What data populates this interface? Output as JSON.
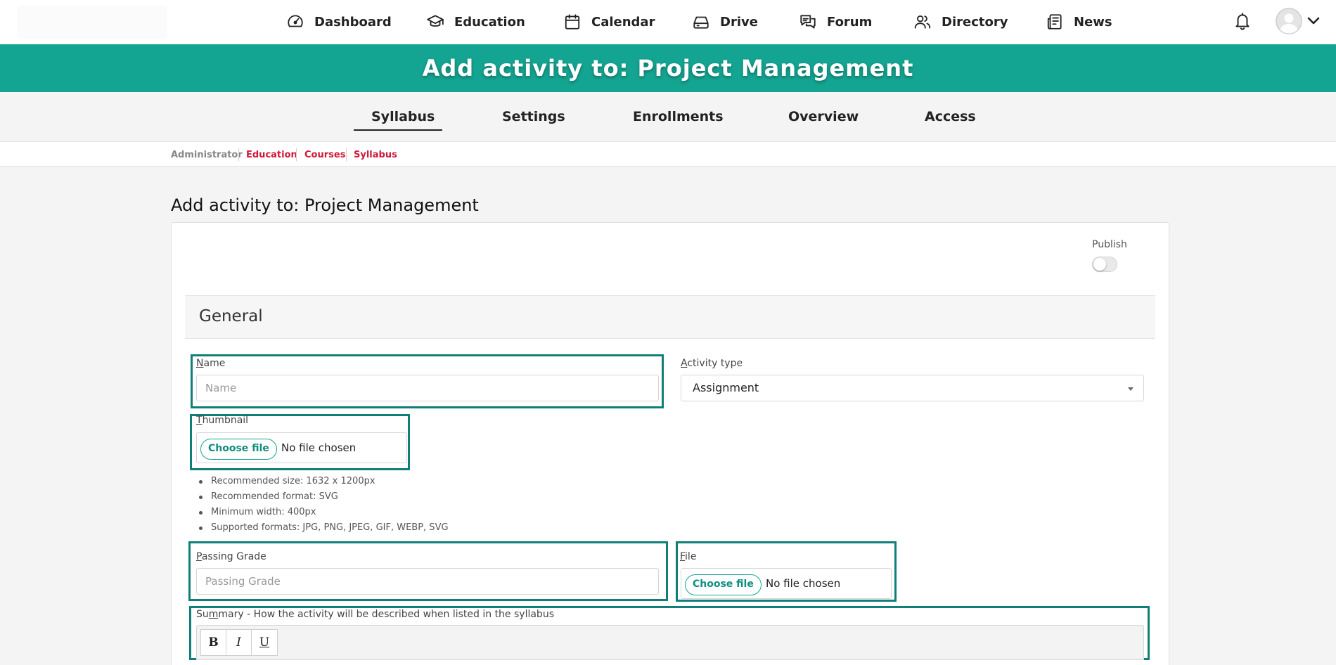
{
  "nav": {
    "items": [
      {
        "label": "Dashboard",
        "icon": "dashboard-gauge-icon"
      },
      {
        "label": "Education",
        "icon": "graduation-cap-icon"
      },
      {
        "label": "Calendar",
        "icon": "calendar-icon"
      },
      {
        "label": "Drive",
        "icon": "drive-icon"
      },
      {
        "label": "Forum",
        "icon": "chat-bubbles-icon"
      },
      {
        "label": "Directory",
        "icon": "people-icon"
      },
      {
        "label": "News",
        "icon": "newspaper-icon"
      }
    ],
    "notifications_icon": "bell-icon",
    "user_icon": "user-avatar-icon"
  },
  "banner": {
    "title": "Add activity to: Project Management"
  },
  "tabs": [
    {
      "label": "Syllabus",
      "active": true
    },
    {
      "label": "Settings"
    },
    {
      "label": "Enrollments"
    },
    {
      "label": "Overview"
    },
    {
      "label": "Access"
    }
  ],
  "breadcrumb": [
    {
      "label": "Administrator"
    },
    {
      "label": "Education"
    },
    {
      "label": "Courses"
    },
    {
      "label": "Syllabus"
    }
  ],
  "page_title": "Add activity to: Project Management",
  "form": {
    "publish_label": "Publish",
    "publish_on": false,
    "section_title": "General",
    "name": {
      "label_first": "N",
      "label_rest": "ame",
      "placeholder": "Name",
      "value": ""
    },
    "activity_type": {
      "label_first": "A",
      "label_rest": "ctivity type",
      "value": "Assignment"
    },
    "thumbnail": {
      "label_first": "T",
      "label_rest": "humbnail",
      "button": "Choose file",
      "status": "No file chosen"
    },
    "thumbnail_hints": [
      "Recommended size: 1632 x 1200px",
      "Recommended format: SVG",
      "Minimum width: 400px",
      "Supported formats: JPG, PNG, JPEG, GIF, WEBP, SVG"
    ],
    "passing_grade": {
      "label_first": "P",
      "label_rest": "assing Grade",
      "placeholder": "Passing Grade",
      "value": ""
    },
    "file": {
      "label_first": "F",
      "label_rest": "ile",
      "button": "Choose file",
      "status": "No file chosen"
    },
    "summary": {
      "label_pre": "Su",
      "label_underline": "m",
      "label_rest": "mary - How the activity will be described when listed in the syllabus"
    },
    "editor_buttons": [
      "B",
      "I",
      "U"
    ]
  },
  "colors": {
    "accent": "#14a592",
    "highlight_border": "#0f7f78",
    "breadcrumb_link": "#d0193a"
  }
}
